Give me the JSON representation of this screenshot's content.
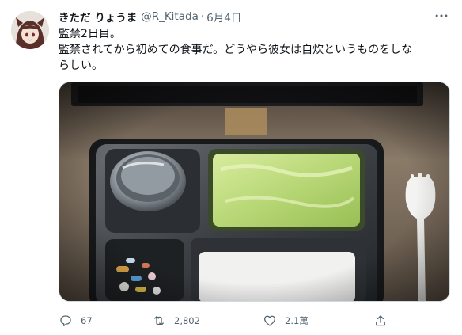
{
  "author": {
    "display_name": "きただ りょうま",
    "handle": "@R_Kitada",
    "separator": "·",
    "date": "6月4日"
  },
  "tweet": {
    "line1": "監禁2日目。",
    "line2": "監禁されてから初めての食事だ。どうやら彼女は自炊というものをしな",
    "line3": "らしい。"
  },
  "media": {
    "alt_subject": "meal tray"
  },
  "stats": {
    "replies": "67",
    "retweets": "2,802",
    "likes": "2.1萬"
  },
  "icons": {
    "more": "more-icon",
    "reply": "reply-icon",
    "retweet": "retweet-icon",
    "like": "heart-icon",
    "share": "share-icon"
  },
  "colors": {
    "text_primary": "#0f1419",
    "text_secondary": "#536471",
    "border": "#cfd9de"
  }
}
